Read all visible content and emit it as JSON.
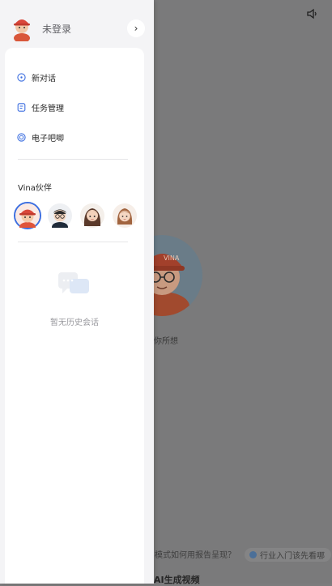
{
  "background": {
    "caption_fragment": "你所想",
    "suggestions": [
      "模式如何用报告呈现？",
      "行业入门该先看哪"
    ],
    "section_title": "AI生成视频"
  },
  "drawer": {
    "user": {
      "status_label": "未登录",
      "arrow_glyph": "›"
    },
    "menu": [
      {
        "label": "新对话",
        "icon": "chat-plus-icon"
      },
      {
        "label": "任务管理",
        "icon": "task-icon"
      },
      {
        "label": "电子吧唧",
        "icon": "badge-icon"
      }
    ],
    "partners_title": "Vina伙伴",
    "partners": [
      {
        "name": "red-cap-boy",
        "selected": true
      },
      {
        "name": "glasses-man",
        "selected": false
      },
      {
        "name": "long-hair-girl",
        "selected": false
      },
      {
        "name": "brown-hair-girl",
        "selected": false
      }
    ],
    "empty_history": "暂无历史会话"
  },
  "colors": {
    "accent": "#3d6fe0",
    "drawer_bg": "#f4f4f6",
    "overlay": "#7a7a7b"
  }
}
